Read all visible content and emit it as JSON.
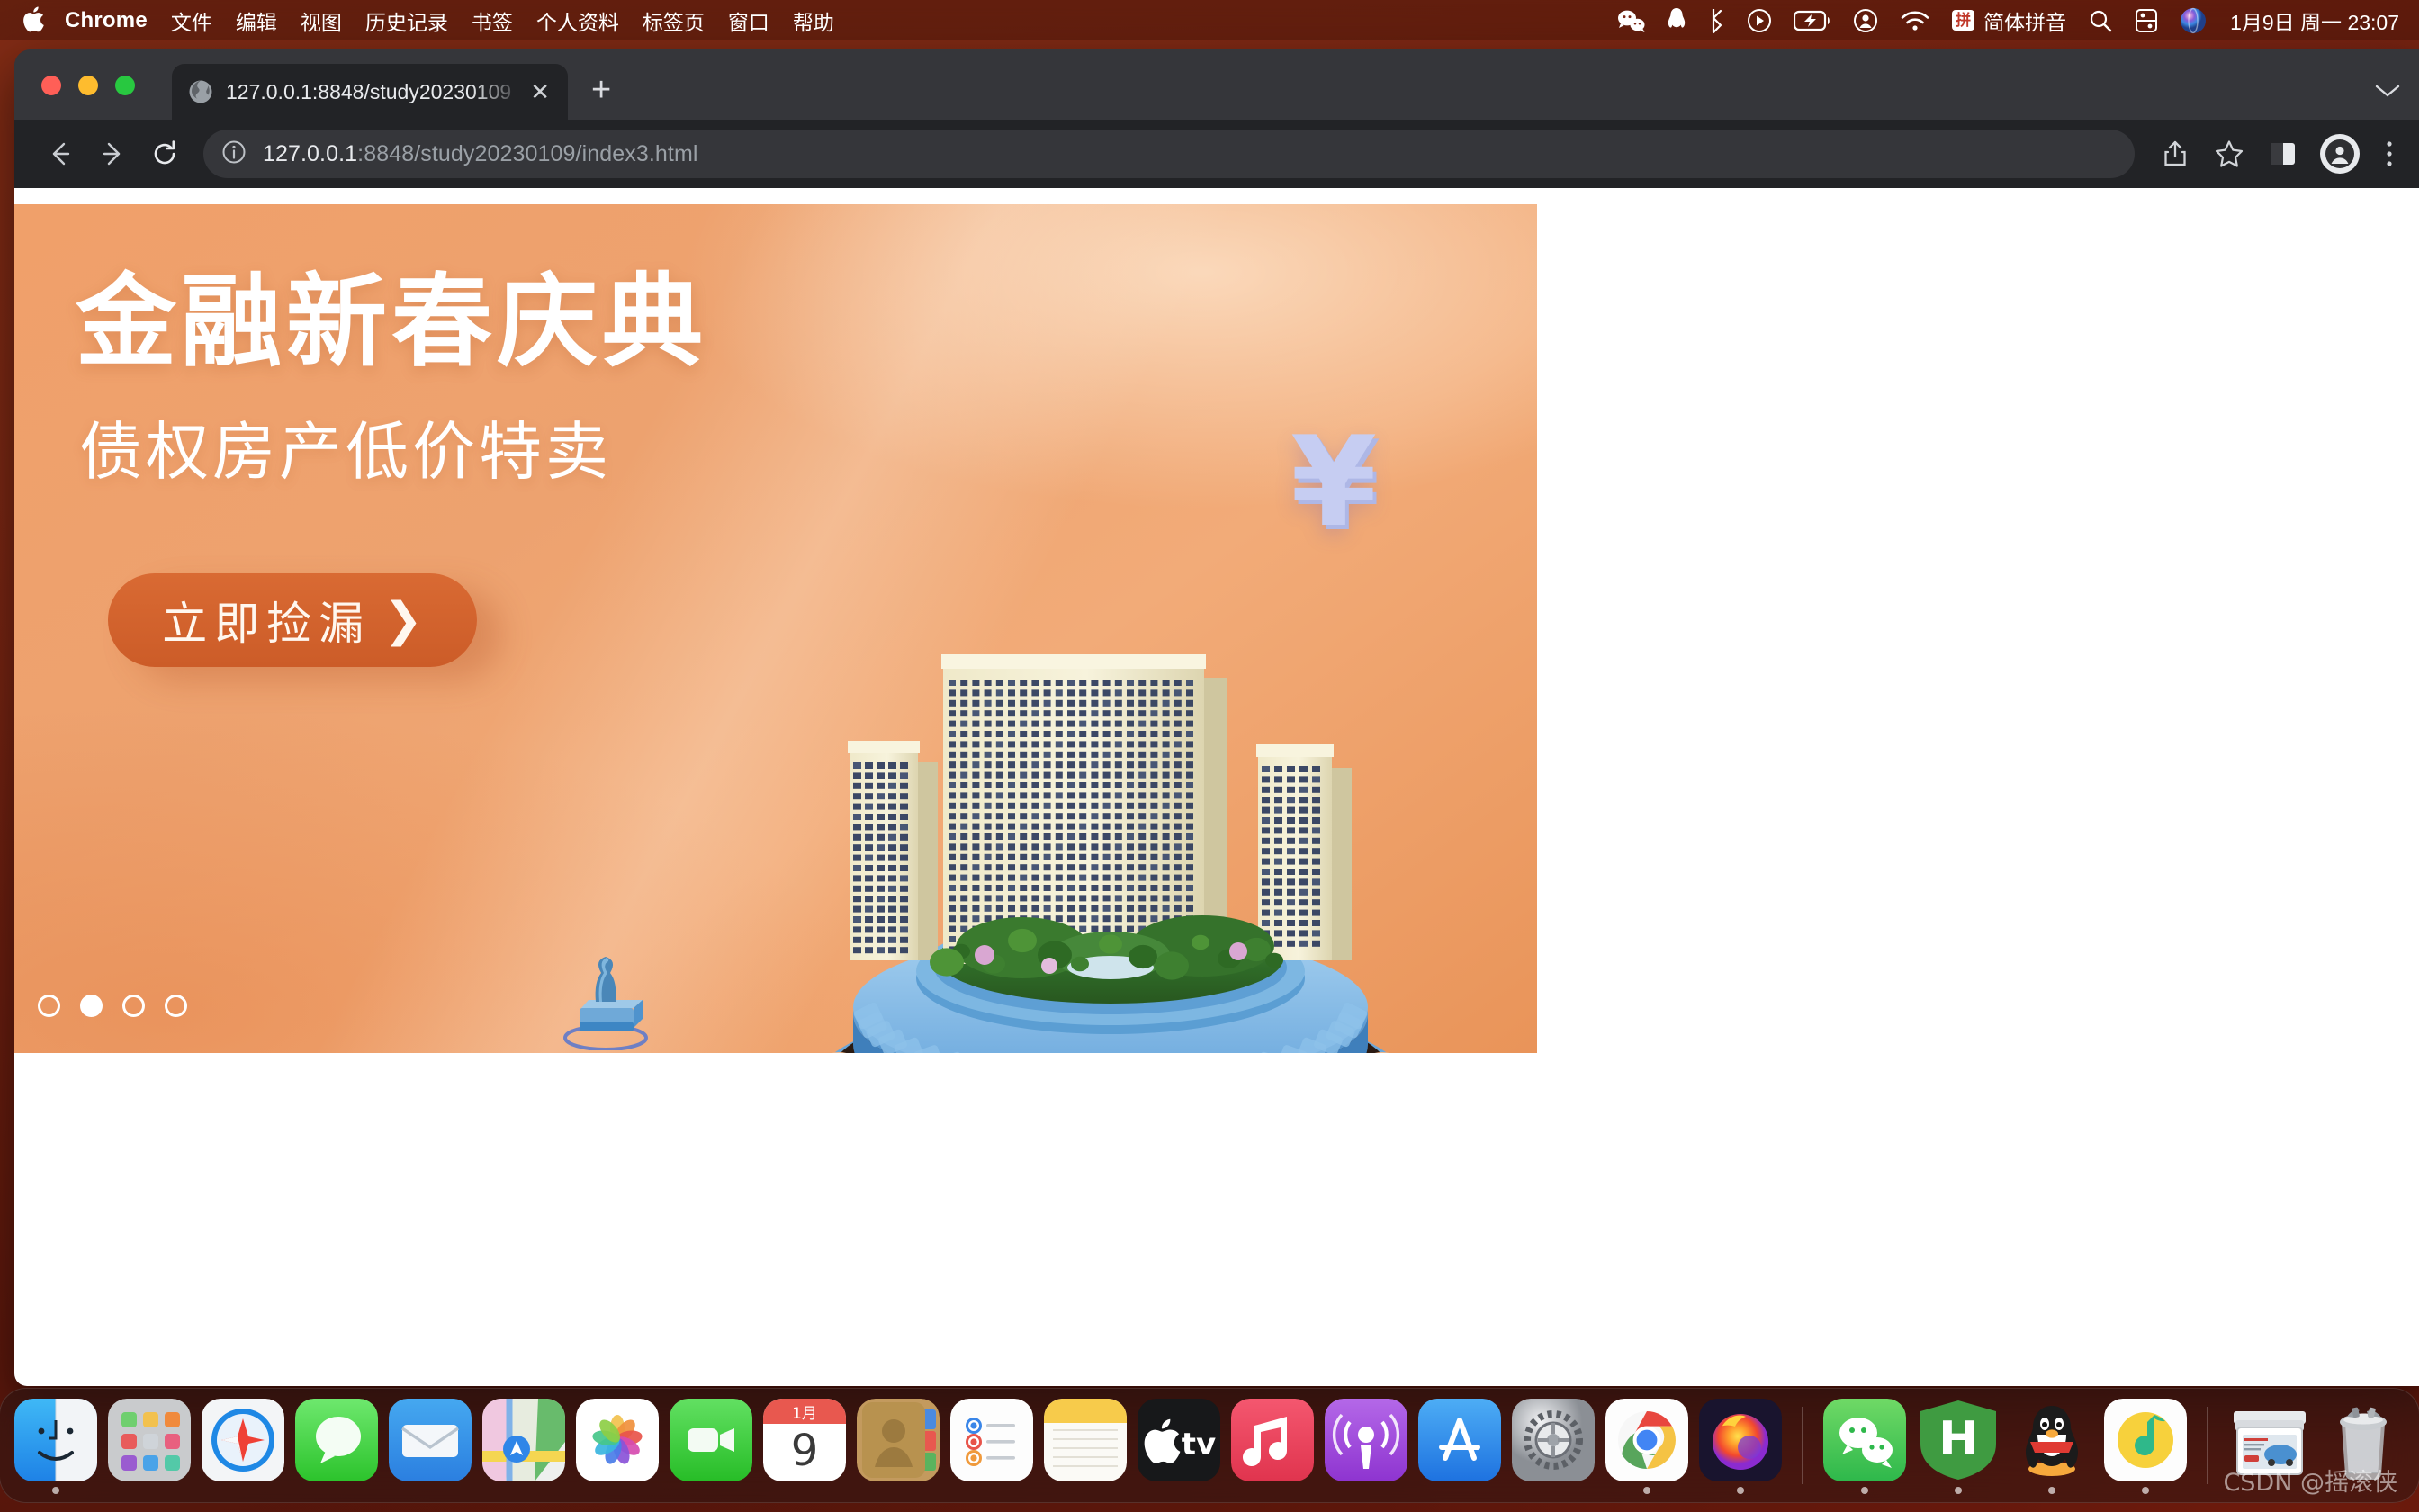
{
  "menubar": {
    "apple_icon": "apple-logo-icon",
    "app_name": "Chrome",
    "items": [
      "文件",
      "编辑",
      "视图",
      "历史记录",
      "书签",
      "个人资料",
      "标签页",
      "窗口",
      "帮助"
    ],
    "status_icons": [
      "wechat-icon",
      "qq-icon",
      "bluetooth-icon",
      "screen-record-icon",
      "battery-charging-icon",
      "user-account-icon",
      "wifi-icon"
    ],
    "ime": {
      "badge": "拼",
      "label": "简体拼音"
    },
    "right_icons": [
      "search-icon",
      "control-center-icon",
      "siri-icon"
    ],
    "clock": "1月9日 周一  23:07"
  },
  "browser": {
    "traffic_lights": [
      "close",
      "minimize",
      "maximize"
    ],
    "tab": {
      "favicon": "globe-icon",
      "title": "127.0.0.1:8848/study20230109",
      "close_label": "✕"
    },
    "new_tab_label": "+",
    "toolbar": {
      "back_icon": "arrow-left-icon",
      "forward_icon": "arrow-right-icon",
      "reload_icon": "reload-icon",
      "site_info_icon": "info-circle-icon",
      "url_host": "127.0.0.1",
      "url_rest": ":8848/study20230109/index3.html",
      "share_icon": "share-icon",
      "bookmark_icon": "star-icon",
      "side_panel_icon": "side-panel-icon",
      "profile_icon": "profile-avatar-icon",
      "menu_icon": "three-dot-menu-icon"
    }
  },
  "page": {
    "banner": {
      "title": "金融新春庆典",
      "subtitle": "债权房产低价特卖",
      "cta_label": "立即捡漏",
      "cta_chevron": "❯",
      "yen_glyph": "¥",
      "bg_accent": "#f0a06a",
      "cta_color": "#d05f2a",
      "carousel": {
        "count": 4,
        "active_index": 1
      }
    }
  },
  "dock": {
    "items": [
      {
        "name": "finder",
        "running": true
      },
      {
        "name": "launchpad",
        "running": false
      },
      {
        "name": "safari",
        "running": false
      },
      {
        "name": "messages",
        "running": false
      },
      {
        "name": "mail",
        "running": false
      },
      {
        "name": "maps",
        "running": false
      },
      {
        "name": "photos",
        "running": false
      },
      {
        "name": "facetime",
        "running": false
      },
      {
        "name": "calendar",
        "running": false,
        "month": "1月",
        "day": "9"
      },
      {
        "name": "contacts",
        "running": false
      },
      {
        "name": "reminders",
        "running": false
      },
      {
        "name": "notes",
        "running": false
      },
      {
        "name": "apple-tv",
        "running": false
      },
      {
        "name": "music",
        "running": false
      },
      {
        "name": "podcasts",
        "running": false
      },
      {
        "name": "app-store",
        "running": false
      },
      {
        "name": "system-settings",
        "running": false
      },
      {
        "name": "chrome",
        "running": true
      },
      {
        "name": "firefox",
        "running": true
      },
      {
        "name": "wechat",
        "running": true
      },
      {
        "name": "hbuilder",
        "running": true
      },
      {
        "name": "qq",
        "running": true
      },
      {
        "name": "qq-music",
        "running": true
      },
      {
        "name": "downloads-stack",
        "running": false
      },
      {
        "name": "trash",
        "running": false
      }
    ]
  },
  "watermark": "CSDN @摇滚侠"
}
